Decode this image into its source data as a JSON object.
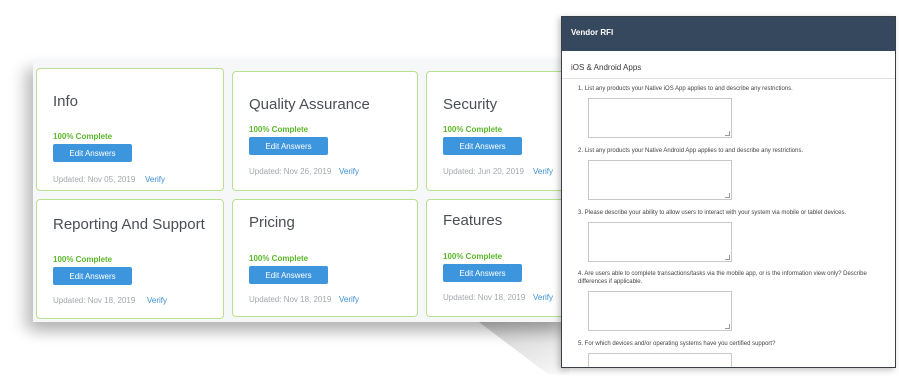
{
  "dashboard": {
    "cards": [
      {
        "title": "Info",
        "status": "100% Complete",
        "button": "Edit Answers",
        "updated": "Updated: Nov 05, 2019",
        "verify": "Verify"
      },
      {
        "title": "Quality Assurance",
        "status": "100% Complete",
        "button": "Edit Answers",
        "updated": "Updated: Nov 26, 2019",
        "verify": "Verify"
      },
      {
        "title": "Security",
        "status": "100% Complete",
        "button": "Edit Answers",
        "updated": "Updated: Jun 20, 2019",
        "verify": "Verify"
      },
      {
        "title": "Reporting And Support",
        "status": "100% Complete",
        "button": "Edit Answers",
        "updated": "Updated: Nov 18, 2019",
        "verify": "Verify"
      },
      {
        "title": "Pricing",
        "status": "100% Complete",
        "button": "Edit Answers",
        "updated": "Updated: Nov 18, 2019",
        "verify": "Verify"
      },
      {
        "title": "Features",
        "status": "100% Complete",
        "button": "Edit Answers",
        "updated": "Updated: Nov 18, 2019",
        "verify": "Verify"
      }
    ],
    "colors": {
      "card_border": "#b9e08e",
      "complete": "#5cb82b",
      "button": "#3d96dd",
      "link": "#3d8ed2"
    }
  },
  "rfi": {
    "header": "Vendor RFI",
    "section": "iOS & Android Apps",
    "questions": [
      {
        "text": "1. List any products your Native iOS App applies to and describe any restrictions.",
        "answer": ""
      },
      {
        "text": "2. List any products your Native Android App applies to and describe any restrictions.",
        "answer": ""
      },
      {
        "text": "3. Please describe your ability to allow users to interact with your system via mobile or tablet devices.",
        "answer": ""
      },
      {
        "text": "4. Are users able to complete transactions/tasks via the mobile app, or is the information view only? Describe differences if applicable.",
        "answer": ""
      },
      {
        "text": "5. For which devices and/or operating systems have you certified support?",
        "answer": ""
      }
    ],
    "colors": {
      "header_bg": "#36485d"
    }
  }
}
